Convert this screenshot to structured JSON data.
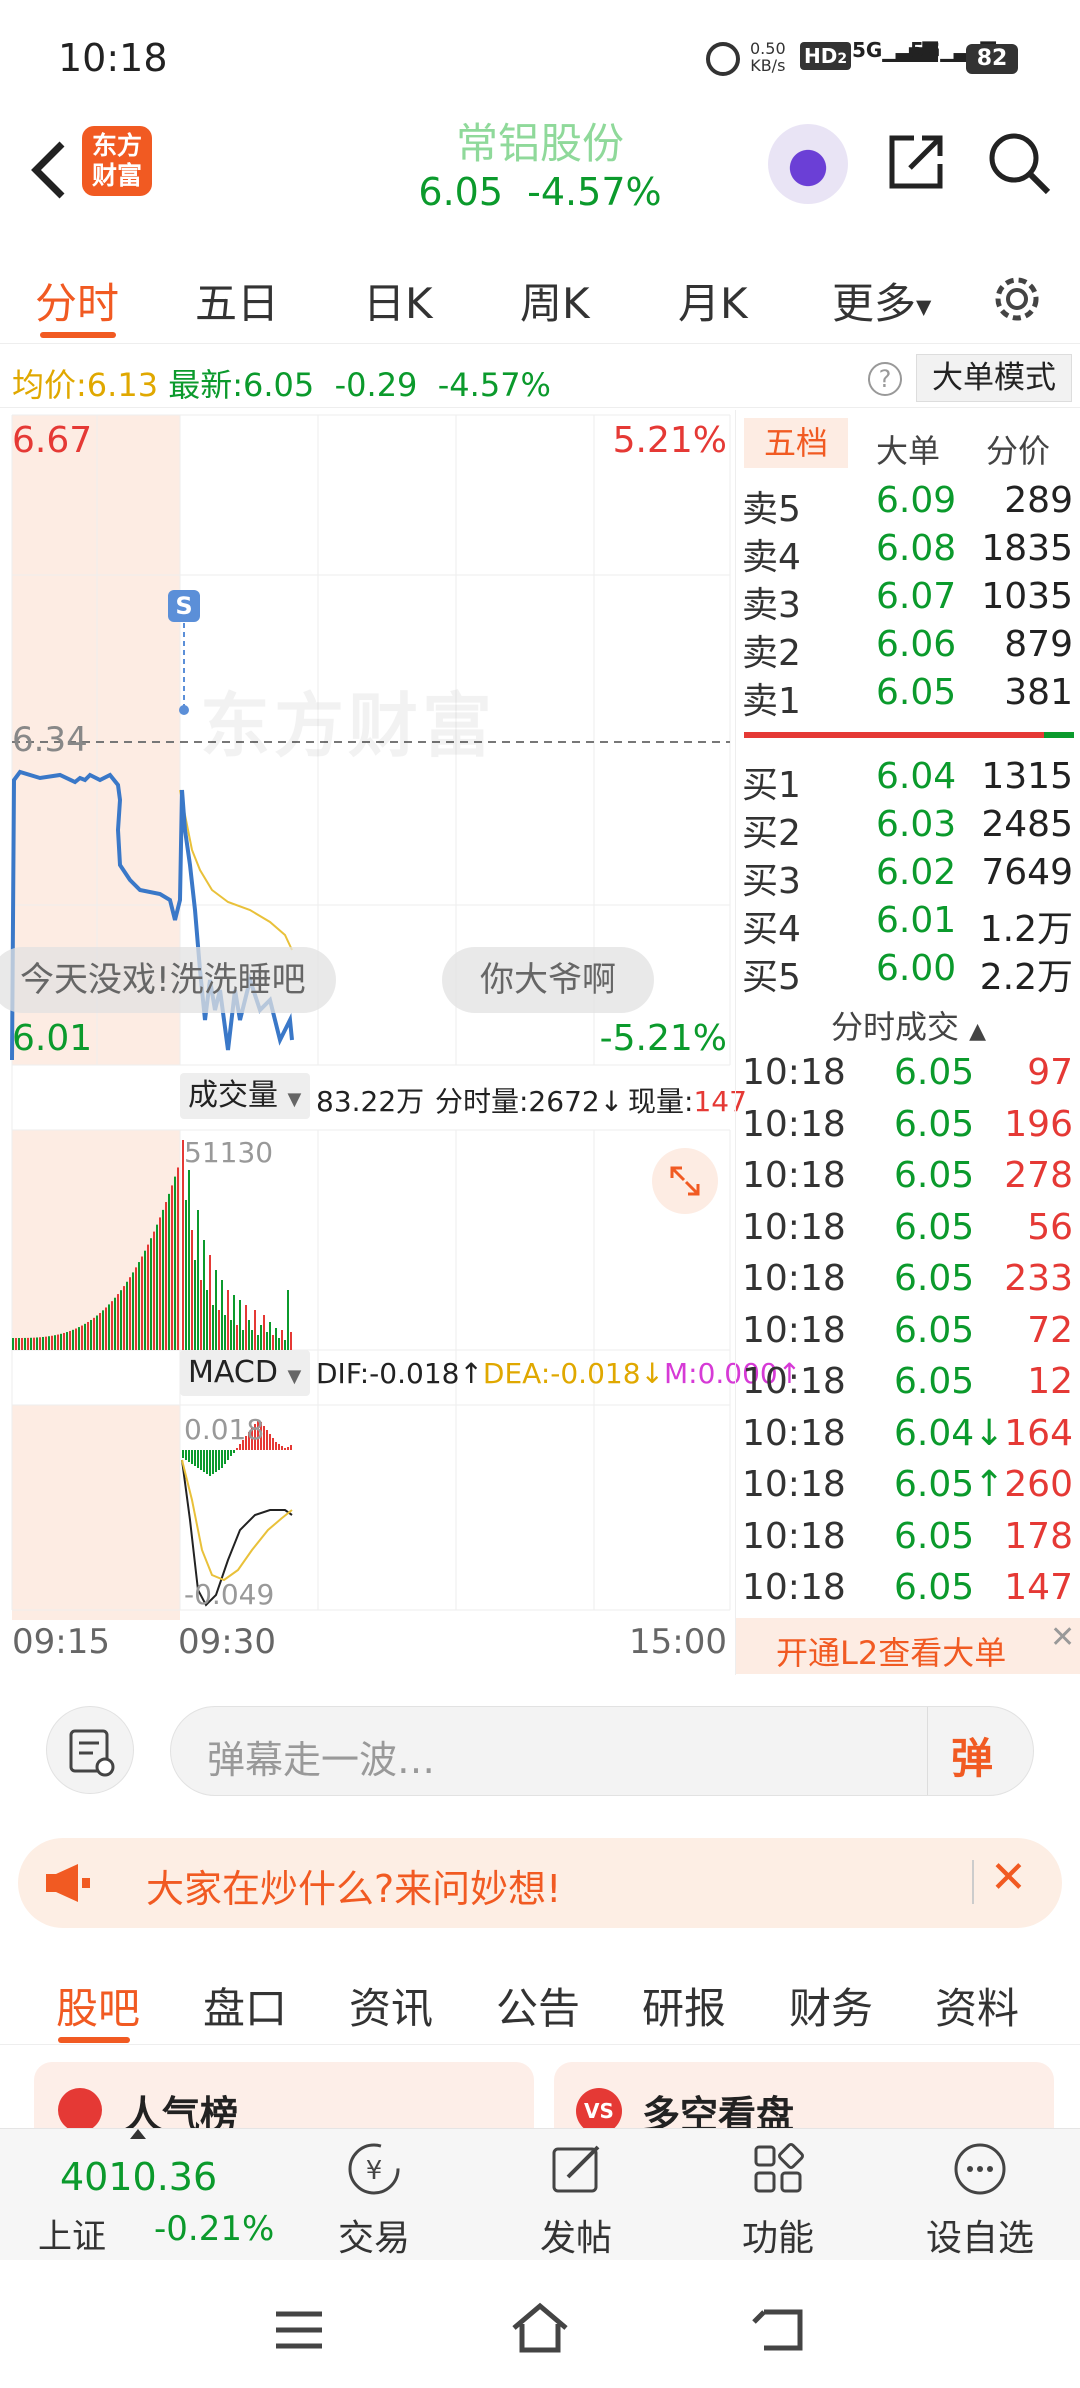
{
  "status": {
    "time": "10:18",
    "net_speed_top": "0.50",
    "net_speed_bottom": "KB/s",
    "hd": "HD",
    "hd_sub": "2",
    "sig1": "5G",
    "sig2": "5G",
    "battery": "82"
  },
  "header": {
    "stock_name": "常铝股份",
    "price": "6.05",
    "change_pct": "-4.57%",
    "logo_line1": "东方",
    "logo_line2": "财富"
  },
  "tabs": [
    "分时",
    "五日",
    "日K",
    "周K",
    "月K",
    "更多"
  ],
  "infobar": {
    "avg_label": "均价:",
    "avg_value": "6.13",
    "latest_label": "最新:",
    "latest_value": "6.05",
    "change": "-0.29",
    "change_pct": "-4.57%",
    "help": "?",
    "mode_button": "大单模式"
  },
  "chart": {
    "price_high": "6.67",
    "price_ref": "6.34",
    "price_low": "6.01",
    "pct_high": "5.21%",
    "pct_low": "-5.21%",
    "watermark": "东方财富",
    "marker": "S",
    "danmaku1": "今天没戏!洗洗睡吧",
    "danmaku2": "你大爷啊",
    "volume_label": "成交量",
    "volume_total": "83.22万",
    "volume_fenshi": "分时量:2672↓",
    "volume_now_label": "现量:",
    "volume_now": "147",
    "volume_max": "51130",
    "macd_label": "MACD",
    "dif": "DIF:-0.018↑",
    "dea": "DEA:-0.018↓",
    "m": "M:0.000↑",
    "macd_top": "0.018",
    "macd_bottom": "-0.049",
    "time_start": "09:15",
    "time_open": "09:30",
    "time_end": "15:00"
  },
  "orderbook": {
    "tabs": [
      "五档",
      "大单",
      "分价"
    ],
    "sells": [
      {
        "label": "卖5",
        "price": "6.09",
        "vol": "289"
      },
      {
        "label": "卖4",
        "price": "6.08",
        "vol": "1835"
      },
      {
        "label": "卖3",
        "price": "6.07",
        "vol": "1035"
      },
      {
        "label": "卖2",
        "price": "6.06",
        "vol": "879"
      },
      {
        "label": "卖1",
        "price": "6.05",
        "vol": "381"
      }
    ],
    "buys": [
      {
        "label": "买1",
        "price": "6.04",
        "vol": "1315"
      },
      {
        "label": "买2",
        "price": "6.03",
        "vol": "2485"
      },
      {
        "label": "买3",
        "price": "6.02",
        "vol": "7649"
      },
      {
        "label": "买4",
        "price": "6.01",
        "vol": "1.2万"
      },
      {
        "label": "买5",
        "price": "6.00",
        "vol": "2.2万"
      }
    ],
    "ticks_title": "分时成交",
    "ticks": [
      {
        "t": "10:18",
        "p": "6.05",
        "v": "97"
      },
      {
        "t": "10:18",
        "p": "6.05",
        "v": "196"
      },
      {
        "t": "10:18",
        "p": "6.05",
        "v": "278"
      },
      {
        "t": "10:18",
        "p": "6.05",
        "v": "56"
      },
      {
        "t": "10:18",
        "p": "6.05",
        "v": "233"
      },
      {
        "t": "10:18",
        "p": "6.05",
        "v": "72"
      },
      {
        "t": "10:18",
        "p": "6.05",
        "v": "12"
      },
      {
        "t": "10:18",
        "p": "6.04↓",
        "v": "164"
      },
      {
        "t": "10:18",
        "p": "6.05↑",
        "v": "260"
      },
      {
        "t": "10:18",
        "p": "6.05",
        "v": "178"
      },
      {
        "t": "10:18",
        "p": "6.05",
        "v": "147"
      }
    ],
    "l2_banner": "开通L2查看大单"
  },
  "comment": {
    "placeholder": "弹幕走一波…",
    "danmu_button": "弹"
  },
  "banner": {
    "text": "大家在炒什么?来问妙想!"
  },
  "bottom_tabs": [
    "股吧",
    "盘口",
    "资讯",
    "公告",
    "研报",
    "财务",
    "资料"
  ],
  "cards": [
    {
      "title": "人气榜"
    },
    {
      "title": "多空看盘",
      "badge": "VS"
    }
  ],
  "bottom_nav": {
    "index_value": "4010.36",
    "index_name": "上证",
    "index_change": "-0.21%",
    "items": [
      "交易",
      "发帖",
      "功能",
      "设自选"
    ]
  }
}
